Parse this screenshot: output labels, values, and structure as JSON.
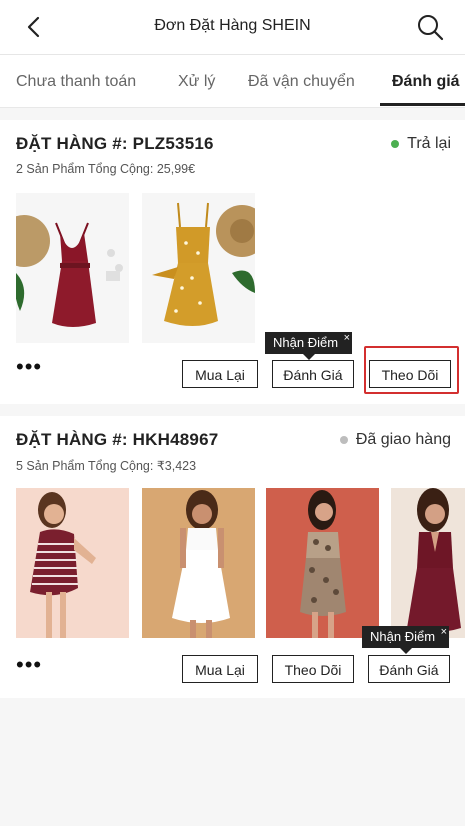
{
  "header": {
    "title": "Đơn Đặt Hàng SHEIN",
    "back_icon": "back-arrow-icon",
    "search_icon": "search-icon"
  },
  "tabs": [
    {
      "label": "Chưa thanh toán"
    },
    {
      "label": "Xử lý"
    },
    {
      "label": "Đã vận chuyển"
    },
    {
      "label": "Đánh giá",
      "active": true
    }
  ],
  "orders": [
    {
      "id_label": "ĐẶT HÀNG #: PLZ53516",
      "summary": "2 Sản Phẩm Tổng Cộng: 25,99€",
      "status": "Trả lại",
      "status_color": "#4caf50",
      "more": "•••",
      "buttons": [
        "Mua Lại",
        "Đánh Giá",
        "Theo Dõi"
      ],
      "tooltip": "Nhận Điểm",
      "tooltip_close": "×"
    },
    {
      "id_label": "ĐẶT HÀNG #: HKH48967",
      "summary": "5 Sản Phẩm Tổng Cộng: ₹3,423",
      "status": "Đã giao hàng",
      "status_color": "#bdbdbd",
      "more": "•••",
      "buttons": [
        "Mua Lại",
        "Theo Dõi",
        "Đánh Giá"
      ],
      "tooltip": "Nhận Điểm",
      "tooltip_close": "×"
    }
  ],
  "colors": {
    "highlight": "#d32f2f",
    "tooltip_bg": "#222222",
    "page_bg": "#f6f6f6"
  }
}
